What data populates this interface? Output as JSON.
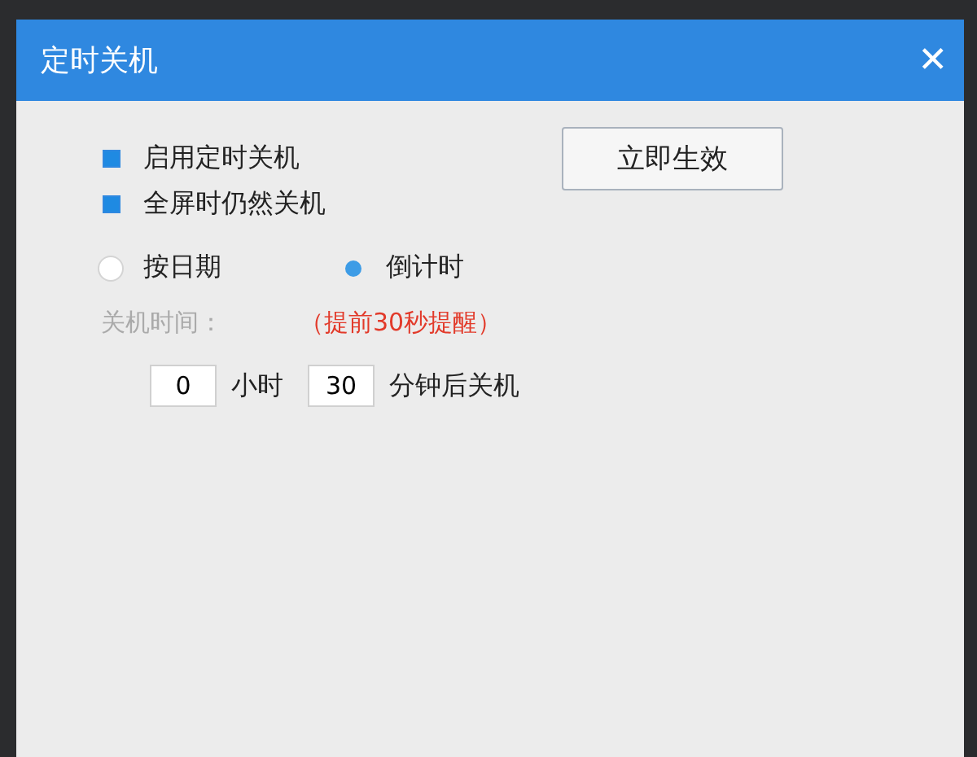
{
  "window": {
    "title": "定时关机",
    "close": "✕"
  },
  "options": [
    {
      "label": "启用定时关机",
      "checked": true
    },
    {
      "label": "全屏时仍然关机",
      "checked": true
    }
  ],
  "apply_button": "立即生效",
  "modes": [
    {
      "label": "按日期",
      "selected": false
    },
    {
      "label": "倒计时",
      "selected": true
    }
  ],
  "time_label": "关机时间：",
  "reminder": "（提前30秒提醒）",
  "hours": {
    "value": "0",
    "unit": "小时"
  },
  "minutes": {
    "value": "30",
    "unit": "分钟后关机"
  }
}
